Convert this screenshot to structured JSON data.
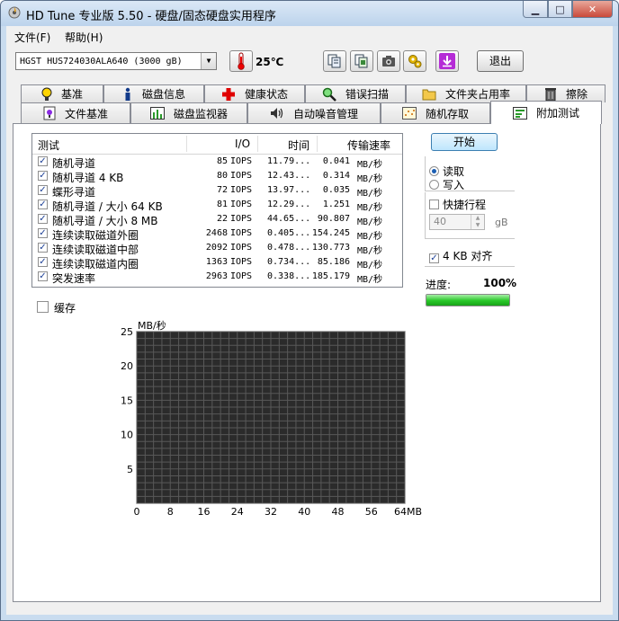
{
  "window": {
    "title": "HD Tune 专业版 5.50 - 硬盘/固态硬盘实用程序",
    "min_glyph": "▁",
    "max_glyph": "□",
    "close_glyph": "✕"
  },
  "menu": [
    "文件(F)",
    "帮助(H)"
  ],
  "toolbar": {
    "drive": "HGST HUS724030ALA640 (3000 gB)",
    "temperature": "25℃",
    "exit_label": "退出",
    "icons": [
      "copy-text-icon",
      "copy-screen-icon",
      "camera-icon",
      "settings-icon",
      "download-icon"
    ]
  },
  "tabs": {
    "row1": [
      "基准",
      "磁盘信息",
      "健康状态",
      "错误扫描",
      "文件夹占用率",
      "擦除"
    ],
    "row2": [
      "文件基准",
      "磁盘监视器",
      "自动噪音管理",
      "随机存取",
      "附加测试"
    ],
    "active": "附加测试"
  },
  "results": {
    "headers": {
      "test": "测试",
      "io": "I/O",
      "time": "时间",
      "rate": "传输速率"
    },
    "rows": [
      {
        "checked": true,
        "name": "随机寻道",
        "io": "85",
        "io_unit": "IOPS",
        "time": "11.79...",
        "rate": "0.041",
        "rate_unit": "MB/秒"
      },
      {
        "checked": true,
        "name": "随机寻道 4 KB",
        "io": "80",
        "io_unit": "IOPS",
        "time": "12.43...",
        "rate": "0.314",
        "rate_unit": "MB/秒"
      },
      {
        "checked": true,
        "name": "蝶形寻道",
        "io": "72",
        "io_unit": "IOPS",
        "time": "13.97...",
        "rate": "0.035",
        "rate_unit": "MB/秒"
      },
      {
        "checked": true,
        "name": "随机寻道 / 大小 64 KB",
        "io": "81",
        "io_unit": "IOPS",
        "time": "12.29...",
        "rate": "1.251",
        "rate_unit": "MB/秒"
      },
      {
        "checked": true,
        "name": "随机寻道 / 大小 8 MB",
        "io": "22",
        "io_unit": "IOPS",
        "time": "44.65...",
        "rate": "90.807",
        "rate_unit": "MB/秒"
      },
      {
        "checked": true,
        "name": "连续读取磁道外圈",
        "io": "2468",
        "io_unit": "IOPS",
        "time": "0.405...",
        "rate": "154.245",
        "rate_unit": "MB/秒"
      },
      {
        "checked": true,
        "name": "连续读取磁道中部",
        "io": "2092",
        "io_unit": "IOPS",
        "time": "0.478...",
        "rate": "130.773",
        "rate_unit": "MB/秒"
      },
      {
        "checked": true,
        "name": "连续读取磁道内圈",
        "io": "1363",
        "io_unit": "IOPS",
        "time": "0.734...",
        "rate": "85.186",
        "rate_unit": "MB/秒"
      },
      {
        "checked": true,
        "name": "突发速率",
        "io": "2963",
        "io_unit": "IOPS",
        "time": "0.338...",
        "rate": "185.179",
        "rate_unit": "MB/秒"
      }
    ]
  },
  "cache_label": "缓存",
  "controls": {
    "start_label": "开始",
    "read_label": "读取",
    "write_label": "写入",
    "mode": "read",
    "short_stroke_label": "快捷行程",
    "short_stroke_checked": false,
    "short_stroke_value": "40",
    "short_stroke_unit": "gB",
    "align_label": "4 KB 对齐",
    "align_checked": true,
    "progress_label": "进度:",
    "progress_text": "100%",
    "progress_value": 1.0
  },
  "chart_data": {
    "type": "line",
    "ylabel": "MB/秒",
    "y_ticks": [
      5,
      10,
      15,
      20,
      25
    ],
    "ylim": [
      0,
      25
    ],
    "x_ticks": [
      "0",
      "8",
      "16",
      "24",
      "32",
      "40",
      "48",
      "56",
      "64MB"
    ],
    "xlim": [
      0,
      64
    ],
    "grid": true,
    "series": []
  }
}
